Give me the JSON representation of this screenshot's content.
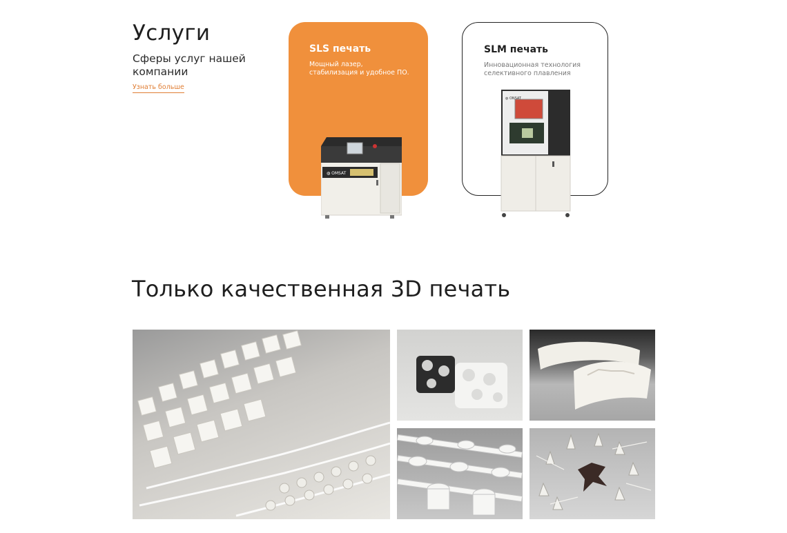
{
  "services": {
    "title": "Услуги",
    "subtitle": "Сферы услуг нашей компании",
    "more_link": "Узнать больше"
  },
  "cards": [
    {
      "title": "SLS печать",
      "desc": "Мощный лазер, стабилизация и удобное ПО."
    },
    {
      "title": "SLM печать",
      "desc": "Инновационная технология селективного плавления"
    }
  ],
  "quality": {
    "title": "Только качественная 3D печать"
  },
  "colors": {
    "accent": "#f0903c",
    "link": "#e07d33",
    "text": "#1f1f1f"
  }
}
